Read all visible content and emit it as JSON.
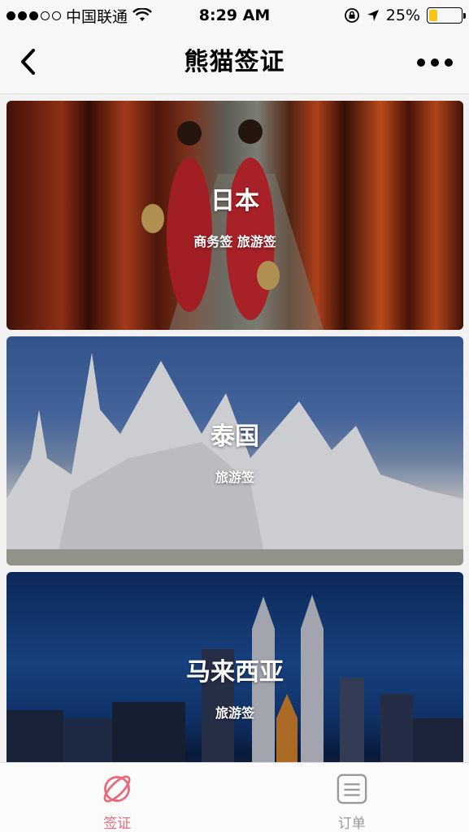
{
  "status_bar": {
    "carrier": "中国联通",
    "time": "8:29 AM",
    "battery_percent": "25%",
    "battery_level": 0.25
  },
  "nav": {
    "title": "熊猫签证",
    "back_icon": "chevron-left-icon",
    "more_icon": "more-dots-icon"
  },
  "cards": [
    {
      "title": "日本",
      "subtitle": "商务签 旅游签"
    },
    {
      "title": "泰国",
      "subtitle": "旅游签"
    },
    {
      "title": "马来西亚",
      "subtitle": "旅游签"
    }
  ],
  "tabs": [
    {
      "label": "签证",
      "icon": "planet-icon",
      "active": true
    },
    {
      "label": "订单",
      "icon": "list-icon",
      "active": false
    }
  ],
  "colors": {
    "accent": "#e8697a",
    "inactive": "#9a9a9a",
    "battery": "#f5c518"
  }
}
